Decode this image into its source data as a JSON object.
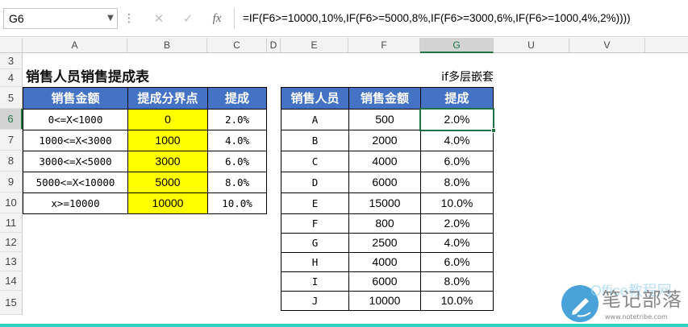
{
  "name_box": "G6",
  "formula": "=IF(F6>=10000,10%,IF(F6>=5000,8%,IF(F6>=3000,6%,IF(F6>=1000,4%,2%))))",
  "icons": {
    "cancel": "✕",
    "enter": "✓",
    "fx": "fx",
    "dots": "⋮",
    "dropdown": "▼"
  },
  "columns": [
    "A",
    "B",
    "C",
    "D",
    "E",
    "F",
    "G",
    "U",
    "V"
  ],
  "rows": [
    "3",
    "4",
    "5",
    "6",
    "7",
    "8",
    "9",
    "10",
    "11",
    "12",
    "13",
    "14",
    "15"
  ],
  "title": "销售人员销售提成表",
  "subtitle": "if多层嵌套",
  "left_table": {
    "headers": [
      "销售金额",
      "提成分界点",
      "提成"
    ],
    "rows": [
      [
        "0<=X<1000",
        "0",
        "2.0%"
      ],
      [
        "1000<=X<3000",
        "1000",
        "4.0%"
      ],
      [
        "3000<=X<5000",
        "3000",
        "6.0%"
      ],
      [
        "5000<=X<10000",
        "5000",
        "8.0%"
      ],
      [
        "x>=10000",
        "10000",
        "10.0%"
      ]
    ]
  },
  "right_table": {
    "headers": [
      "销售人员",
      "销售金额",
      "提成"
    ],
    "rows": [
      [
        "A",
        "500",
        "2.0%"
      ],
      [
        "B",
        "2000",
        "4.0%"
      ],
      [
        "C",
        "4000",
        "6.0%"
      ],
      [
        "D",
        "6000",
        "8.0%"
      ],
      [
        "E",
        "15000",
        "10.0%"
      ],
      [
        "F",
        "800",
        "2.0%"
      ],
      [
        "G",
        "2500",
        "4.0%"
      ],
      [
        "H",
        "4000",
        "6.0%"
      ],
      [
        "I",
        "6000",
        "8.0%"
      ],
      [
        "J",
        "10000",
        "10.0%"
      ]
    ]
  },
  "watermark": {
    "text": "笔记部落",
    "office": "Office教程网",
    "url": "www.notetribe.com"
  },
  "colors": {
    "header_blue": "#4472c4",
    "highlight_yellow": "#ffff00",
    "excel_green": "#217346"
  }
}
